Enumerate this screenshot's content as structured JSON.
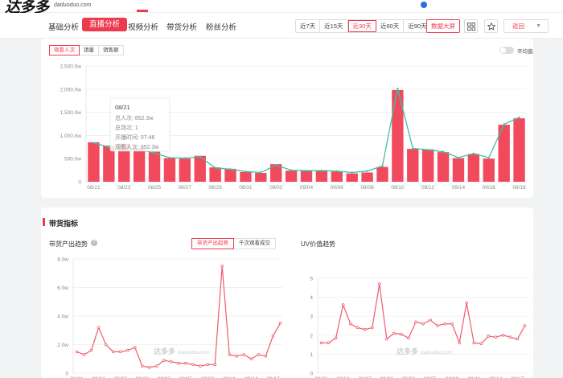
{
  "header": {
    "logo_text": "达多多",
    "logo_sub": "daduoduo.com"
  },
  "nav": {
    "tabs": [
      "基础分析",
      "直播分析",
      "视频分析",
      "带货分析",
      "粉丝分析"
    ],
    "active_tab": 1,
    "ranges": [
      "近7天",
      "近15天",
      "近30天",
      "近60天",
      "近90天"
    ],
    "active_range": 2,
    "screen_btn": "数据大屏",
    "back_btn": "返回"
  },
  "colors": {
    "accent": "#ee3a4e",
    "line_green": "#3fc1a5",
    "bar_red": "#f04a5c"
  },
  "live_panel": {
    "subtabs": [
      "观看人次",
      "销量",
      "销售额"
    ],
    "active_subtab": 0,
    "toggle_label": "平均值",
    "tooltip": {
      "date": "08/21",
      "lines": [
        "总人次:  852.3w",
        "总场次:  1",
        "开播时间:  07:46",
        "观看人次:  852.3w"
      ]
    }
  },
  "goods_panel": {
    "title": "带货指标",
    "left_title": "带货产出趋势",
    "left_buttons": [
      "带货产出趋势",
      "千次观看成交"
    ],
    "left_active_button": 0,
    "right_title": "UV价值趋势",
    "watermark": "达多多",
    "watermark_sub": "daduoduo.com"
  },
  "chart_data": [
    {
      "type": "bar",
      "title": "",
      "y_ticks": [
        "0",
        "500.0w",
        "1,000.0w",
        "1,500.0w",
        "2,000.0w",
        "2,500.0w"
      ],
      "ylim": [
        0,
        2500
      ],
      "x_tick_labels": [
        "08/21",
        "08/23",
        "08/25",
        "08/27",
        "08/29",
        "08/31",
        "09/02",
        "09/04",
        "09/06",
        "09/08",
        "09/10",
        "09/12",
        "09/14",
        "09/16",
        "09/18"
      ],
      "categories": [
        "08/21",
        "08/22",
        "08/23",
        "08/24",
        "08/25",
        "08/26",
        "08/27",
        "08/28",
        "08/29",
        "08/30",
        "08/31",
        "09/01",
        "09/02",
        "09/03",
        "09/04",
        "09/05",
        "09/06",
        "09/07",
        "09/08",
        "09/09",
        "09/10",
        "09/11",
        "09/12",
        "09/13",
        "09/14",
        "09/15",
        "09/16",
        "09/17",
        "09/18"
      ],
      "values": [
        852,
        780,
        820,
        720,
        650,
        510,
        500,
        560,
        310,
        280,
        210,
        190,
        380,
        240,
        250,
        250,
        220,
        180,
        200,
        320,
        1980,
        710,
        700,
        640,
        510,
        600,
        500,
        1230,
        1370
      ],
      "line_values": [
        840,
        750,
        700,
        700,
        620,
        520,
        510,
        540,
        300,
        270,
        220,
        200,
        360,
        250,
        240,
        240,
        230,
        200,
        230,
        340,
        2010,
        720,
        690,
        650,
        520,
        610,
        520,
        1240,
        1390
      ]
    },
    {
      "type": "line",
      "title": "",
      "y_ticks": [
        "0",
        "2.0w",
        "4.0w",
        "6.0w",
        "8.0w"
      ],
      "ylim": [
        0,
        8
      ],
      "x_tick_labels": [
        "08/21",
        "08/24",
        "08/27",
        "08/30",
        "09/02",
        "09/05",
        "09/08",
        "09/11",
        "09/14",
        "09/17"
      ],
      "values": [
        1.5,
        1.3,
        1.6,
        3.2,
        2.0,
        1.5,
        1.5,
        1.6,
        1.8,
        0.5,
        0.4,
        0.5,
        0.9,
        0.8,
        0.7,
        0.7,
        0.6,
        0.5,
        0.6,
        0.6,
        7.5,
        1.3,
        1.2,
        1.3,
        1.0,
        1.3,
        1.2,
        2.6,
        3.5
      ]
    },
    {
      "type": "line",
      "title": "",
      "y_ticks": [
        "0",
        "1",
        "2",
        "3",
        "4",
        "5"
      ],
      "ylim": [
        0,
        5
      ],
      "x_tick_labels": [
        "08/21",
        "08/24",
        "08/27",
        "08/30",
        "09/02",
        "09/05",
        "09/08",
        "09/11",
        "09/14",
        "09/17"
      ],
      "values": [
        1.6,
        1.6,
        1.85,
        3.6,
        2.6,
        2.4,
        2.3,
        2.4,
        4.7,
        1.8,
        2.1,
        2.05,
        1.85,
        2.7,
        2.6,
        2.8,
        2.5,
        2.6,
        2.6,
        1.6,
        3.7,
        1.6,
        1.55,
        1.95,
        1.9,
        2.0,
        1.9,
        1.8,
        2.5
      ]
    }
  ]
}
